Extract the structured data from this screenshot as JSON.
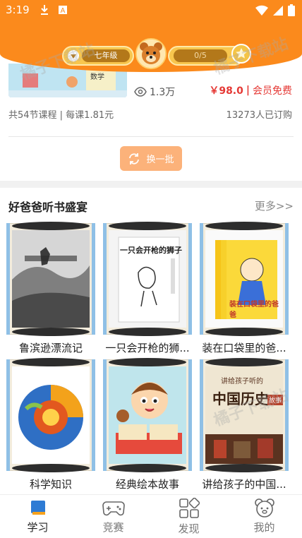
{
  "status_bar": {
    "time": "3:19"
  },
  "header": {
    "grade": "七年级",
    "progress": "0/5",
    "colors": {
      "brand": "#fb8a1c",
      "pill": "#f8c64e",
      "pill_inner": "#b3781a"
    }
  },
  "course": {
    "thumb_text": "数学",
    "views": "1.3万",
    "price": "￥98.0",
    "price_sep": "|",
    "member_label": "会员免费",
    "meta": "共54节课程 | 每课1.81元",
    "subscribers": "13273人已订购"
  },
  "refresh_button": {
    "label": "换一批"
  },
  "section": {
    "title": "好爸爸听书盛宴",
    "more": "更多>>",
    "books": [
      {
        "title": "鲁滨逊漂流记",
        "cover_text": ""
      },
      {
        "title": "一只会开枪的狮...",
        "cover_text": "一只会开枪的狮子"
      },
      {
        "title": "装在口袋里的爸...",
        "cover_text": "装在口袋里的爸爸"
      },
      {
        "title": "科学知识",
        "cover_text": ""
      },
      {
        "title": "经典绘本故事",
        "cover_text": ""
      },
      {
        "title": "讲给孩子的中国...",
        "cover_text": "中国历史",
        "cover_subtext": "讲给孩子听的",
        "cover_tag": "故事"
      }
    ]
  },
  "watermarks": [
    "橘子下载站",
    "橘子下载站",
    "橘子下载站"
  ],
  "bottom_nav": {
    "items": [
      {
        "label": "学习",
        "icon": "book-icon",
        "active": true
      },
      {
        "label": "竞赛",
        "icon": "gamepad-icon",
        "active": false
      },
      {
        "label": "发现",
        "icon": "grid-icon",
        "active": false
      },
      {
        "label": "我的",
        "icon": "bear-face-icon",
        "active": false
      }
    ]
  }
}
